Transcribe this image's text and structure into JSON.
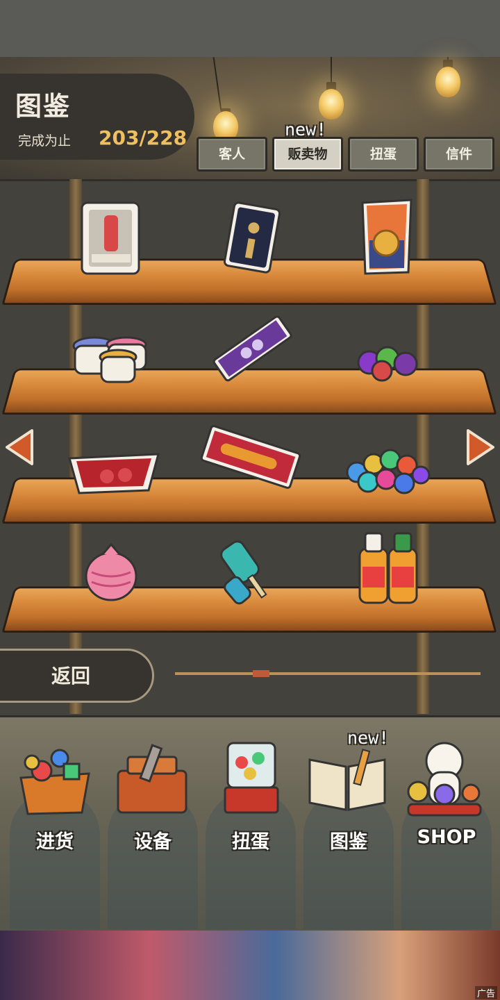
{
  "header": {
    "title": "图鉴",
    "progress_label": "完成为止",
    "progress_value": "203/228"
  },
  "tabs": [
    {
      "label": "客人",
      "active": false
    },
    {
      "label": "贩卖物",
      "active": true,
      "badge": "new!"
    },
    {
      "label": "扭蛋",
      "active": false
    },
    {
      "label": "信件",
      "active": false
    }
  ],
  "shelf_items": [
    {
      "row": 1,
      "icon": "boxed-drink-candy-icon"
    },
    {
      "row": 1,
      "icon": "black-card-pack-icon"
    },
    {
      "row": 1,
      "icon": "coin-candy-bag-icon"
    },
    {
      "row": 2,
      "icon": "pudding-cups-icon"
    },
    {
      "row": 2,
      "icon": "purple-candy-bar-icon"
    },
    {
      "row": 2,
      "icon": "gumdrops-icon"
    },
    {
      "row": 3,
      "icon": "jelly-tray-icon"
    },
    {
      "row": 3,
      "icon": "snack-stick-pack-icon"
    },
    {
      "row": 3,
      "icon": "marble-candies-icon"
    },
    {
      "row": 4,
      "icon": "balloon-candy-icon"
    },
    {
      "row": 4,
      "icon": "ice-pops-icon"
    },
    {
      "row": 4,
      "icon": "fruit-soda-bottles-icon"
    }
  ],
  "back_label": "返回",
  "page_position": 0.27,
  "bottom_nav": [
    {
      "label": "进货",
      "icon": "goods-basket-icon"
    },
    {
      "label": "设备",
      "icon": "toolbox-icon"
    },
    {
      "label": "扭蛋",
      "icon": "gacha-machine-icon"
    },
    {
      "label": "图鉴",
      "icon": "open-book-icon",
      "badge": "new!"
    },
    {
      "label": "SHOP",
      "icon": "lucky-cat-icon"
    }
  ],
  "ad": {
    "label": "广告"
  },
  "colors": {
    "accent": "#f0c060",
    "panel": "#37342f",
    "wood": "#d98a3c",
    "arrow": "#d05a2a"
  }
}
